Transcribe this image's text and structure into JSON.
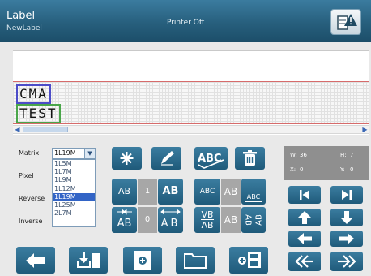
{
  "header": {
    "title": "Label",
    "subtitle": "NewLabel",
    "status": "Printer Off",
    "alert_icon": "printer-warning-icon"
  },
  "canvas": {
    "lines": [
      "CMA",
      "TEST"
    ]
  },
  "left_panel": {
    "labels": [
      "Matrix",
      "Pixel",
      "Reverse",
      "Inverse"
    ],
    "matrix_selected": "1L19M",
    "matrix_options": [
      "1L5M",
      "1L7M",
      "1L9M",
      "1L12M",
      "1L19M",
      "1L25M",
      "2L7M"
    ]
  },
  "tools": {
    "row1_icons": [
      "sparkle-icon",
      "pencil-icon",
      "spellcheck-icon",
      "delete-icon"
    ],
    "font_row1": {
      "left": "AB",
      "mid": "1",
      "right": "AB"
    },
    "font_row2": {
      "left": "AB",
      "mid": "0",
      "right": "AB"
    },
    "style_row1": {
      "left": "ABC",
      "mid": "AB",
      "right": "ABC"
    },
    "style_row2": {
      "left_top": "AB",
      "left_bottom": "AB",
      "mid": "AB",
      "right": "AB"
    }
  },
  "info": {
    "w_label": "W:",
    "w_value": "36",
    "h_label": "H:",
    "h_value": "7",
    "x_label": "X:",
    "x_value": "0",
    "y_label": "Y:",
    "y_value": "0"
  },
  "nav": {
    "icons": [
      "skip-start-icon",
      "skip-end-icon",
      "arrow-up-icon",
      "arrow-down-icon",
      "arrow-left-icon",
      "arrow-right-icon",
      "fast-back-icon",
      "fast-forward-icon"
    ]
  },
  "toolbar": {
    "icons": [
      "back-icon",
      "download-icon",
      "add-field-icon",
      "folder-icon",
      "save-icon"
    ]
  },
  "colors": {
    "header": "#275f7d",
    "button": "#2a6a8c",
    "selection": "#3264c6"
  }
}
